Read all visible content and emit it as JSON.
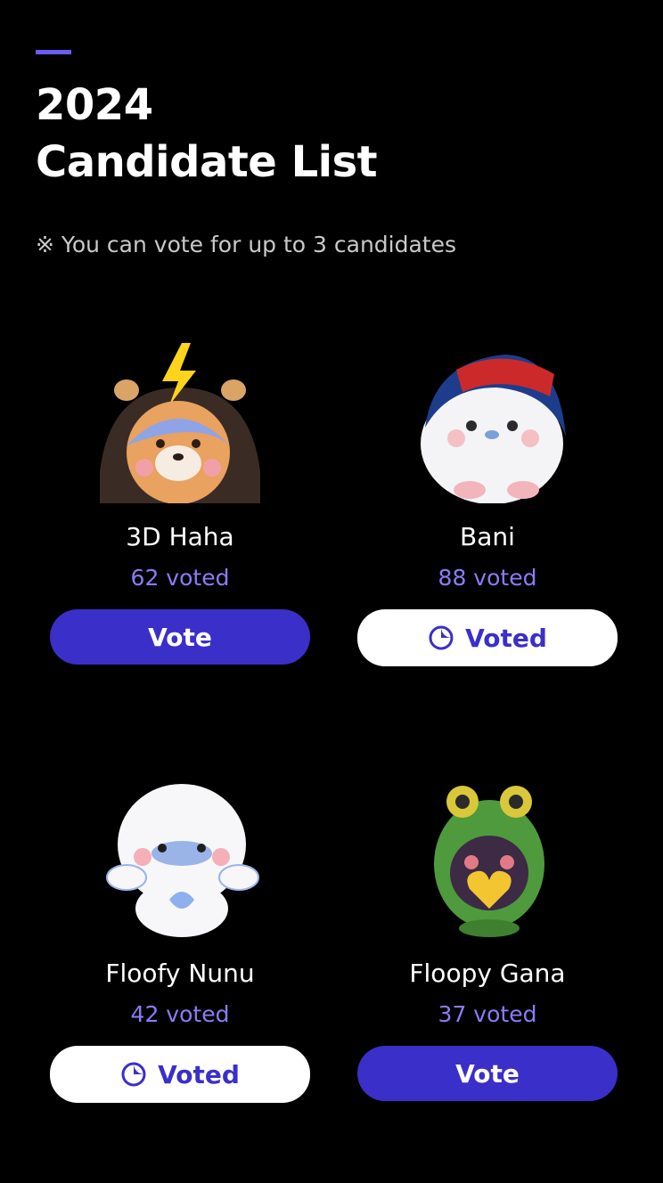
{
  "header": {
    "title_line1": "2024",
    "title_line2": "Candidate List",
    "note": "※ You can vote for up to 3 candidates"
  },
  "colors": {
    "background": "#000000",
    "accent": "#6a5cf0",
    "vote_button": "#3b2fc9",
    "count_text": "#8b7cf6"
  },
  "candidates": [
    {
      "name": "3D Haha",
      "count": "62 voted",
      "button_label": "Vote",
      "state": "vote",
      "avatar_icon": "bear-lightning-icon"
    },
    {
      "name": "Bani",
      "count": "88 voted",
      "button_label": "Voted",
      "state": "voted",
      "avatar_icon": "bunny-cap-icon"
    },
    {
      "name": "Floofy Nunu",
      "count": "42 voted",
      "button_label": "Voted",
      "state": "voted",
      "avatar_icon": "fluffy-seal-icon"
    },
    {
      "name": "Floopy Gana",
      "count": "37 voted",
      "button_label": "Vote",
      "state": "vote",
      "avatar_icon": "frog-heart-icon"
    }
  ]
}
